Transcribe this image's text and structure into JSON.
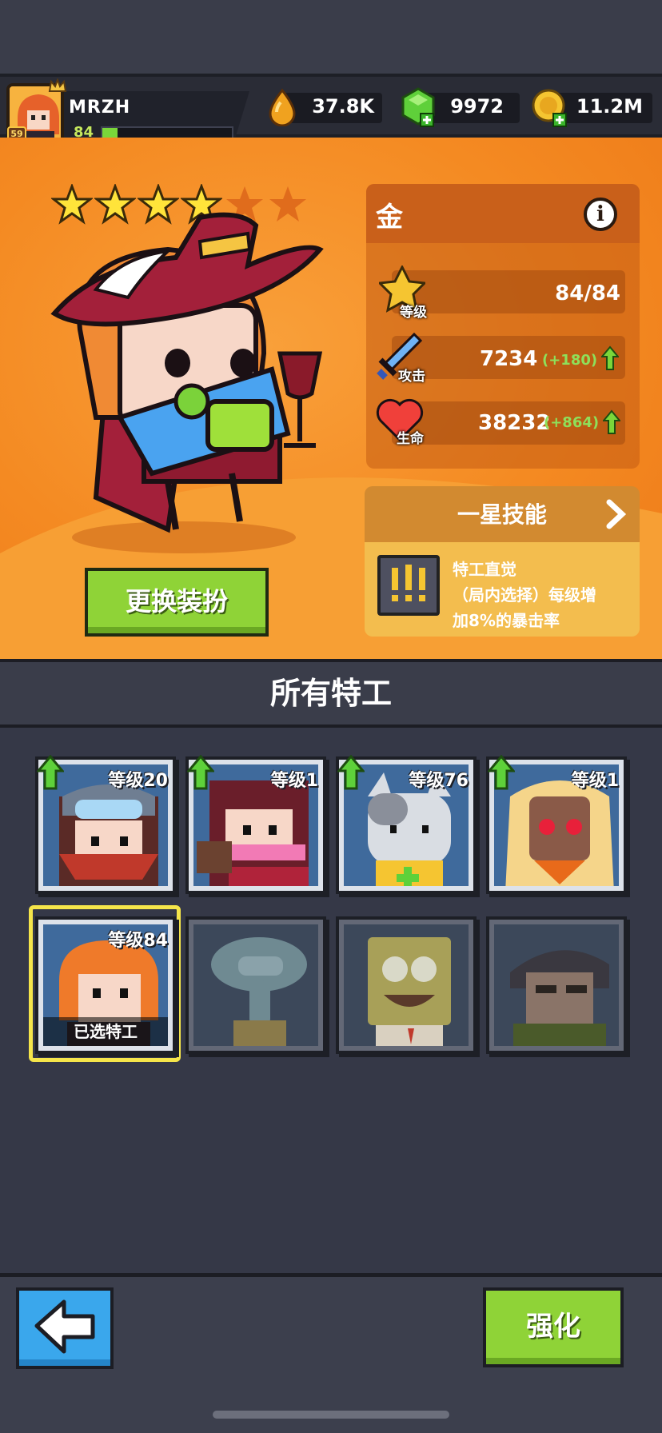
{
  "player": {
    "name": "MRZH",
    "level": "84",
    "avatar_badge": "59",
    "xp_fraction": 0.12
  },
  "resources": [
    {
      "icon": "fuel-drop-icon",
      "value": "37.8K"
    },
    {
      "icon": "green-gem-icon",
      "value": "9972"
    },
    {
      "icon": "gold-coin-icon",
      "value": "11.2M"
    }
  ],
  "hero": {
    "stars_filled": 4,
    "stars_total": 6,
    "rarity": "金",
    "stats": {
      "level": {
        "label": "等级",
        "value": "84/84"
      },
      "attack": {
        "label": "攻击",
        "value": "7234",
        "bonus": "(+180)"
      },
      "life": {
        "label": "生命",
        "value": "38232",
        "bonus": "(+864)"
      }
    },
    "skill": {
      "title": "一星技能",
      "name": "特工直觉",
      "desc_line1": "（局内选择）每级增",
      "desc_line2": "加8%的暴击率"
    },
    "change_outfit_label": "更换装扮"
  },
  "roster": {
    "title": "所有特工",
    "selected_label": "已选特工",
    "agents": [
      {
        "level": "等级20",
        "upgradable": true,
        "locked": false
      },
      {
        "level": "等级1",
        "upgradable": true,
        "locked": false
      },
      {
        "level": "等级76",
        "upgradable": true,
        "locked": false
      },
      {
        "level": "等级1",
        "upgradable": true,
        "locked": false
      },
      {
        "level": "等级84",
        "upgradable": false,
        "locked": false,
        "selected": true
      },
      {
        "level": "",
        "upgradable": false,
        "locked": true
      },
      {
        "level": "",
        "upgradable": false,
        "locked": true
      },
      {
        "level": "",
        "upgradable": false,
        "locked": true
      }
    ]
  },
  "bottom": {
    "upgrade_label": "强化"
  },
  "colors": {
    "accent_green": "#8fd337",
    "hero_orange": "#f48a22",
    "back_blue": "#3aa7ec",
    "bonus_green": "#8ee05a"
  }
}
